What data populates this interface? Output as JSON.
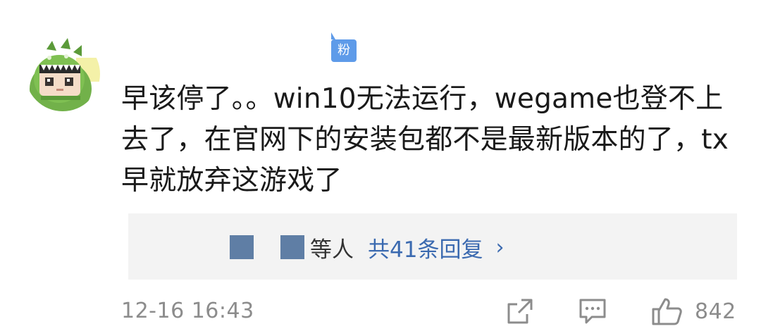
{
  "comment": {
    "badge": "粉",
    "text": "早该停了。。win10无法运行，wegame也登不上去了，在官网下的安装包都不是最新版本的了，tx早就放弃这游戏了",
    "replies": {
      "suffix": "等人",
      "count_label": "共41条回复",
      "chevron": "›"
    },
    "timestamp": "12-16 16:43",
    "likes": "842"
  },
  "icons": {
    "avatar": "green-dinosaur-costume-avatar",
    "share": "share-square-arrow-icon",
    "reply": "comment-bubble-icon",
    "like": "thumbs-up-icon"
  },
  "colors": {
    "badge": "#5e9be9",
    "link": "#3b6ab0",
    "muted": "#8c8c8c",
    "reply_bg": "#f3f3f3"
  }
}
